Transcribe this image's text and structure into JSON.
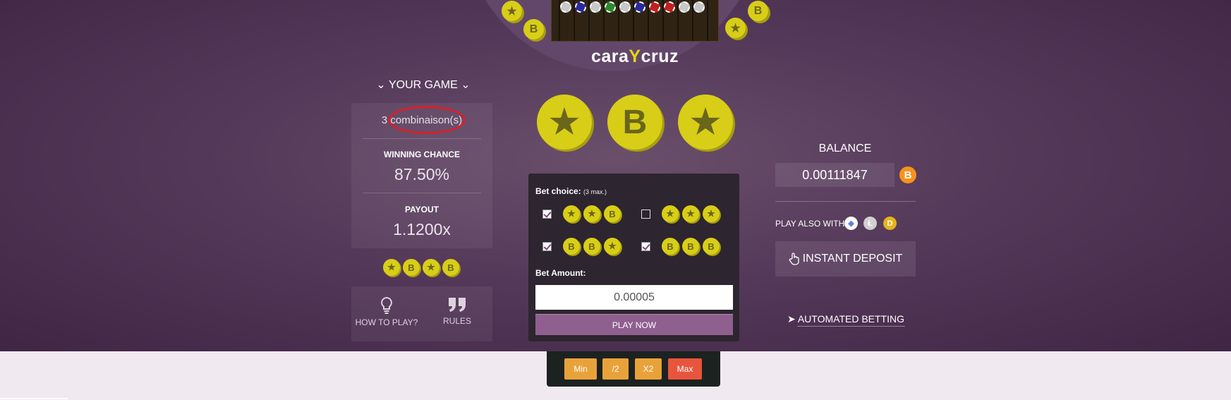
{
  "brand": {
    "part1": "cara",
    "part2": "Y",
    "part3": "cruz"
  },
  "left": {
    "your_game": "YOUR GAME",
    "combinations_prefix": "3",
    "combinations_label": "combinaison(s)",
    "winning_chance_label": "WINNING CHANCE",
    "winning_chance_value": "87.50%",
    "payout_label": "PAYOUT",
    "payout_value": "1.1200x",
    "sequence": [
      "star",
      "B",
      "star",
      "B"
    ],
    "how_to_play": "HOW TO PLAY?",
    "rules": "RULES"
  },
  "result_coins": [
    "star",
    "B",
    "star"
  ],
  "bet": {
    "choice_label": "Bet choice:",
    "choice_max": "(3 max.)",
    "options": [
      {
        "checked": true,
        "coins": [
          "star",
          "star",
          "B"
        ]
      },
      {
        "checked": false,
        "coins": [
          "star",
          "star",
          "star"
        ]
      },
      {
        "checked": true,
        "coins": [
          "B",
          "B",
          "star"
        ]
      },
      {
        "checked": true,
        "coins": [
          "B",
          "B",
          "B"
        ]
      }
    ],
    "amount_label": "Bet Amount:",
    "amount_value": "0.00005",
    "play_label": "PLAY NOW"
  },
  "quick_buttons": {
    "min": "Min",
    "half": "/2",
    "double": "X2",
    "max": "Max"
  },
  "right": {
    "balance_label": "BALANCE",
    "balance_value": "0.00111847",
    "btc_symbol": "B",
    "play_also_label": "PLAY ALSO WITH:",
    "alt_coins": [
      "ethereum-icon",
      "litecoin-icon",
      "dogecoin-icon"
    ],
    "instant_deposit": "INSTANT DEPOSIT",
    "automated_betting": "AUTOMATED BETTING"
  },
  "colors": {
    "coin": "#d8ce17",
    "play": "#8f5f8f",
    "quick": "#e9a23a",
    "max": "#e8553c",
    "btc": "#f7931a"
  }
}
